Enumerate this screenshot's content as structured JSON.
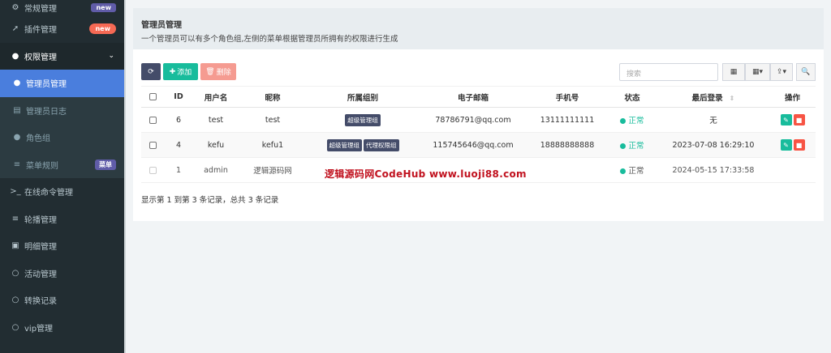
{
  "sidebar": {
    "items": [
      {
        "label": "常规管理",
        "icon": "cogs-icon",
        "badge": "new"
      },
      {
        "label": "插件管理",
        "icon": "rocket-icon",
        "badge": "new"
      },
      {
        "label": "权限管理",
        "icon": "users-icon",
        "chevron": "⌄"
      },
      {
        "label": "管理员管理",
        "icon": "user-icon"
      },
      {
        "label": "管理员日志",
        "icon": "list-alt-icon"
      },
      {
        "label": "角色组",
        "icon": "group-icon"
      },
      {
        "label": "菜单规则",
        "icon": "bars-icon",
        "badge": "菜单"
      },
      {
        "label": "在线命令管理",
        "icon": "terminal-icon"
      },
      {
        "label": "轮播管理",
        "icon": "bars-icon"
      },
      {
        "label": "明细管理",
        "icon": "calendar-icon"
      },
      {
        "label": "活动管理",
        "icon": "circle-icon"
      },
      {
        "label": "转换记录",
        "icon": "circle-icon"
      },
      {
        "label": "vip管理",
        "icon": "circle-icon"
      }
    ]
  },
  "panel": {
    "title": "管理员管理",
    "description": "一个管理员可以有多个角色组,左侧的菜单根据管理员所拥有的权限进行生成"
  },
  "toolbar": {
    "add_label": "添加",
    "delete_label": "删除",
    "search_placeholder": "搜索"
  },
  "table": {
    "headers": [
      "",
      "ID",
      "用户名",
      "昵称",
      "所属组别",
      "电子邮箱",
      "手机号",
      "状态",
      "最后登录",
      "操作"
    ],
    "rows": [
      {
        "id": "6",
        "username": "test",
        "nickname": "test",
        "groups": [
          "超级管理组"
        ],
        "email": "78786791@qq.com",
        "phone": "13111111111",
        "status": "正常",
        "last_login": "无"
      },
      {
        "id": "4",
        "username": "kefu",
        "nickname": "kefu1",
        "groups": [
          "超级管理组",
          "代理权限组"
        ],
        "email": "115745646@qq.com",
        "phone": "18888888888",
        "status": "正常",
        "last_login": "2023-07-08 16:29:10"
      },
      {
        "id": "1",
        "username": "admin",
        "nickname": "逻辑源码网",
        "groups": [],
        "email": "",
        "phone": "",
        "status": "正常",
        "last_login": "2024-05-15 17:33:58"
      }
    ]
  },
  "footer": {
    "info": "显示第 1 到第 3 条记录，总共 3 条记录"
  },
  "watermark": "逻辑源码网CodeHub www.luoji88.com",
  "colors": {
    "sidebar_bg": "#222d32",
    "active": "#4a7edd",
    "success": "#18bc9c",
    "danger": "#f75444",
    "dark_btn": "#444c69"
  }
}
